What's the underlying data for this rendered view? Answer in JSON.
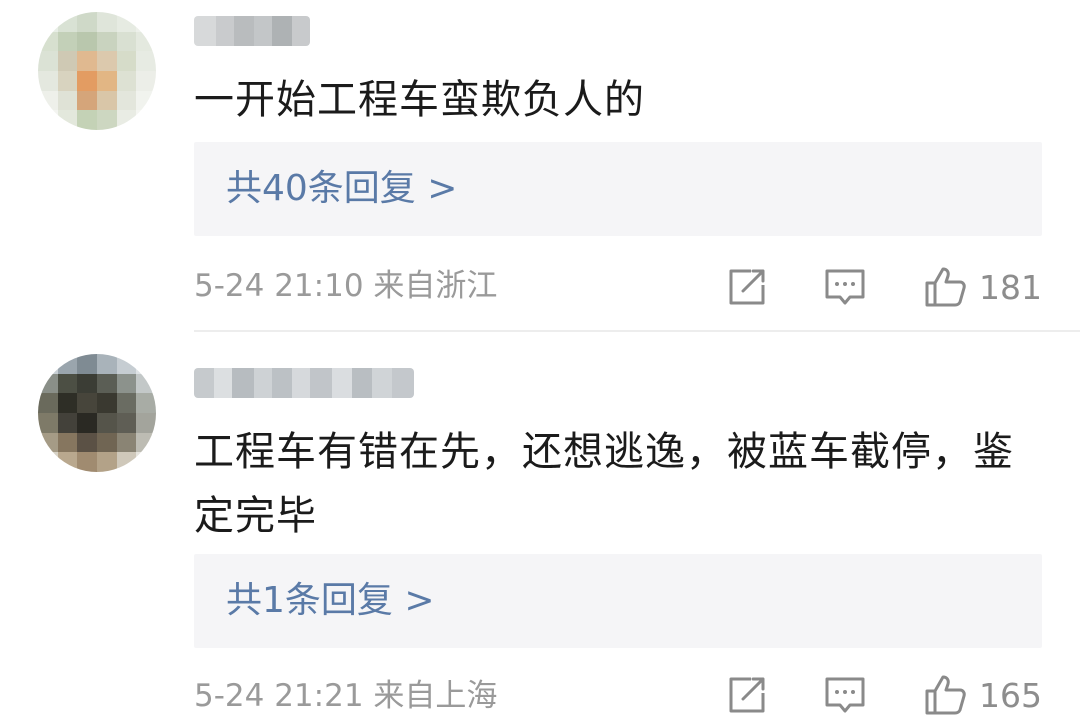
{
  "comments": [
    {
      "text": "一开始工程车蛮欺负人的",
      "reply_label": "共40条回复 >",
      "meta": "5-24 21:10 来自浙江",
      "likes": "181"
    },
    {
      "text": "工程车有错在先，还想逃逸，被蓝车截停，鉴定完毕",
      "reply_label": "共1条回复 >",
      "meta": "5-24 21:21 来自上海",
      "likes": "165"
    }
  ],
  "icons": {
    "share": "share-icon",
    "reply": "comment-icon",
    "like": "thumbs-up-icon"
  },
  "colors": {
    "reply_link": "#5a7aa7",
    "meta_text": "#9a9a9a",
    "reply_bg": "#f5f5f7"
  }
}
